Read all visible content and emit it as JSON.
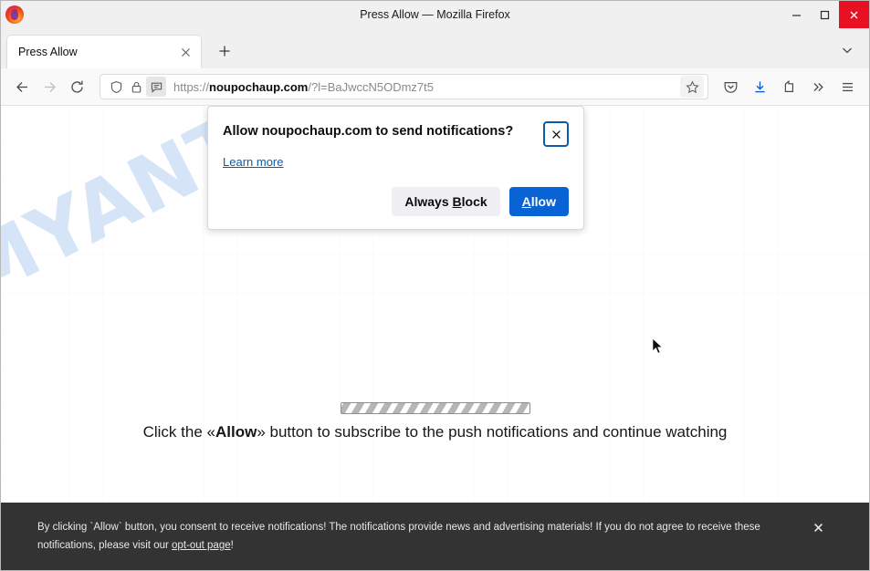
{
  "window": {
    "title": "Press Allow — Mozilla Firefox",
    "logo_icon": "firefox-logo",
    "controls": {
      "minimize": "minimize-icon",
      "maximize": "maximize-icon",
      "close": "close-icon"
    }
  },
  "tabs": {
    "items": [
      {
        "label": "Press Allow",
        "close_icon": "close-icon"
      }
    ],
    "new_tab_icon": "plus-icon",
    "list_all_tabs_icon": "chevron-down-icon"
  },
  "navbar": {
    "back_icon": "back-arrow-icon",
    "forward_icon": "forward-arrow-icon",
    "reload_icon": "reload-icon",
    "shield_icon": "shield-icon",
    "lock_icon": "lock-icon",
    "notification_permission_icon": "speech-bubble-icon",
    "url": {
      "scheme": "https://",
      "host": "noupochaup.com",
      "path": "/?l=BaJwccN5ODmz7t5",
      "full": "https://noupochaup.com/?l=BaJwccN5ODmz7t5"
    },
    "bookmark_icon": "star-icon",
    "pocket_icon": "pocket-icon",
    "downloads_icon": "download-icon",
    "account_icon": "account-icon",
    "overflow_icon": "double-chevron-icon",
    "menu_icon": "hamburger-menu-icon"
  },
  "permission_popup": {
    "title": "Allow noupochaup.com to send notifications?",
    "learn_more": "Learn more",
    "close_icon": "close-icon",
    "block_button": {
      "prefix": "Always ",
      "accesskey": "B",
      "suffix": "lock"
    },
    "allow_button": {
      "accesskey": "A",
      "suffix": "llow"
    },
    "accent_color": "#0a63d4"
  },
  "page": {
    "watermark": "MYANTISPYWARE.COM",
    "watermark_color": "#c9dcf5",
    "headline_prefix": "Click the «",
    "headline_bold": "Allow",
    "headline_suffix": "» button to subscribe to the push notifications and continue watching",
    "progress_label": "loading-progress-bar"
  },
  "consent_banner": {
    "line1": "By clicking `Allow` button, you consent to receive notifications! The notifications provide news and advertising materials! If you do not agree to receive these",
    "line2_prefix": "notifications, please visit our ",
    "link": "opt-out page",
    "line2_suffix": "!",
    "close_icon": "close-icon",
    "background_color": "#333333"
  },
  "cursor": {
    "icon": "mouse-pointer-icon"
  }
}
